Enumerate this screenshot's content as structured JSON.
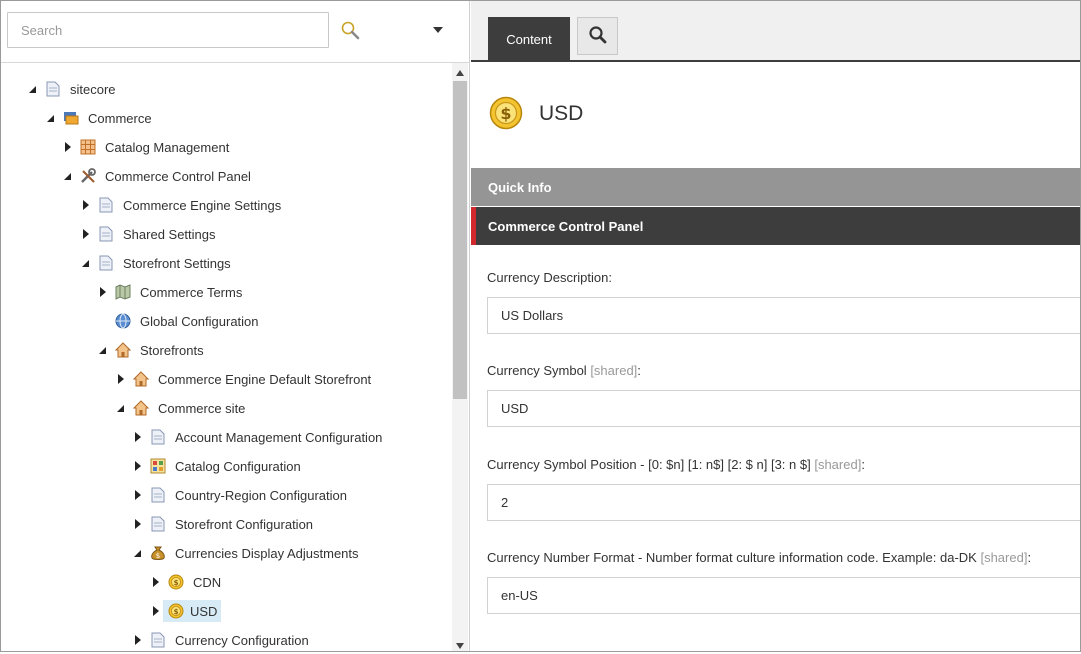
{
  "search": {
    "placeholder": "Search"
  },
  "tree": {
    "nodes": [
      {
        "label": "sitecore"
      },
      {
        "label": "Commerce"
      },
      {
        "label": "Catalog Management"
      },
      {
        "label": "Commerce Control Panel"
      },
      {
        "label": "Commerce Engine Settings"
      },
      {
        "label": "Shared Settings"
      },
      {
        "label": "Storefront Settings"
      },
      {
        "label": "Commerce Terms"
      },
      {
        "label": "Global Configuration"
      },
      {
        "label": "Storefronts"
      },
      {
        "label": "Commerce Engine Default Storefront"
      },
      {
        "label": "Commerce site"
      },
      {
        "label": "Account Management Configuration"
      },
      {
        "label": "Catalog Configuration"
      },
      {
        "label": "Country-Region Configuration"
      },
      {
        "label": "Storefront Configuration"
      },
      {
        "label": "Currencies Display Adjustments"
      },
      {
        "label": "CDN"
      },
      {
        "label": "USD"
      },
      {
        "label": "Currency Configuration"
      }
    ]
  },
  "ribbon": {
    "content_tab": "Content"
  },
  "item": {
    "title": "USD"
  },
  "sections": {
    "quick_info": "Quick Info",
    "control_panel": "Commerce Control Panel"
  },
  "fields": [
    {
      "label": "Currency Description:",
      "shared": "",
      "suffix": "",
      "value": "US Dollars"
    },
    {
      "label": "Currency Symbol ",
      "shared": "[shared]",
      "suffix": ":",
      "value": "USD"
    },
    {
      "label": "Currency Symbol Position - [0: $n] [1: n$] [2: $ n] [3: n $] ",
      "shared": "[shared]",
      "suffix": ":",
      "value": "2"
    },
    {
      "label": "Currency Number Format - Number format culture information code. Example: da-DK ",
      "shared": "[shared]",
      "suffix": ":",
      "value": "en-US"
    }
  ],
  "colors": {
    "selected_bg": "#d7ebf7",
    "section_dark": "#3d3d3d",
    "section_grey": "#959595",
    "accent_red": "#d0282c"
  }
}
